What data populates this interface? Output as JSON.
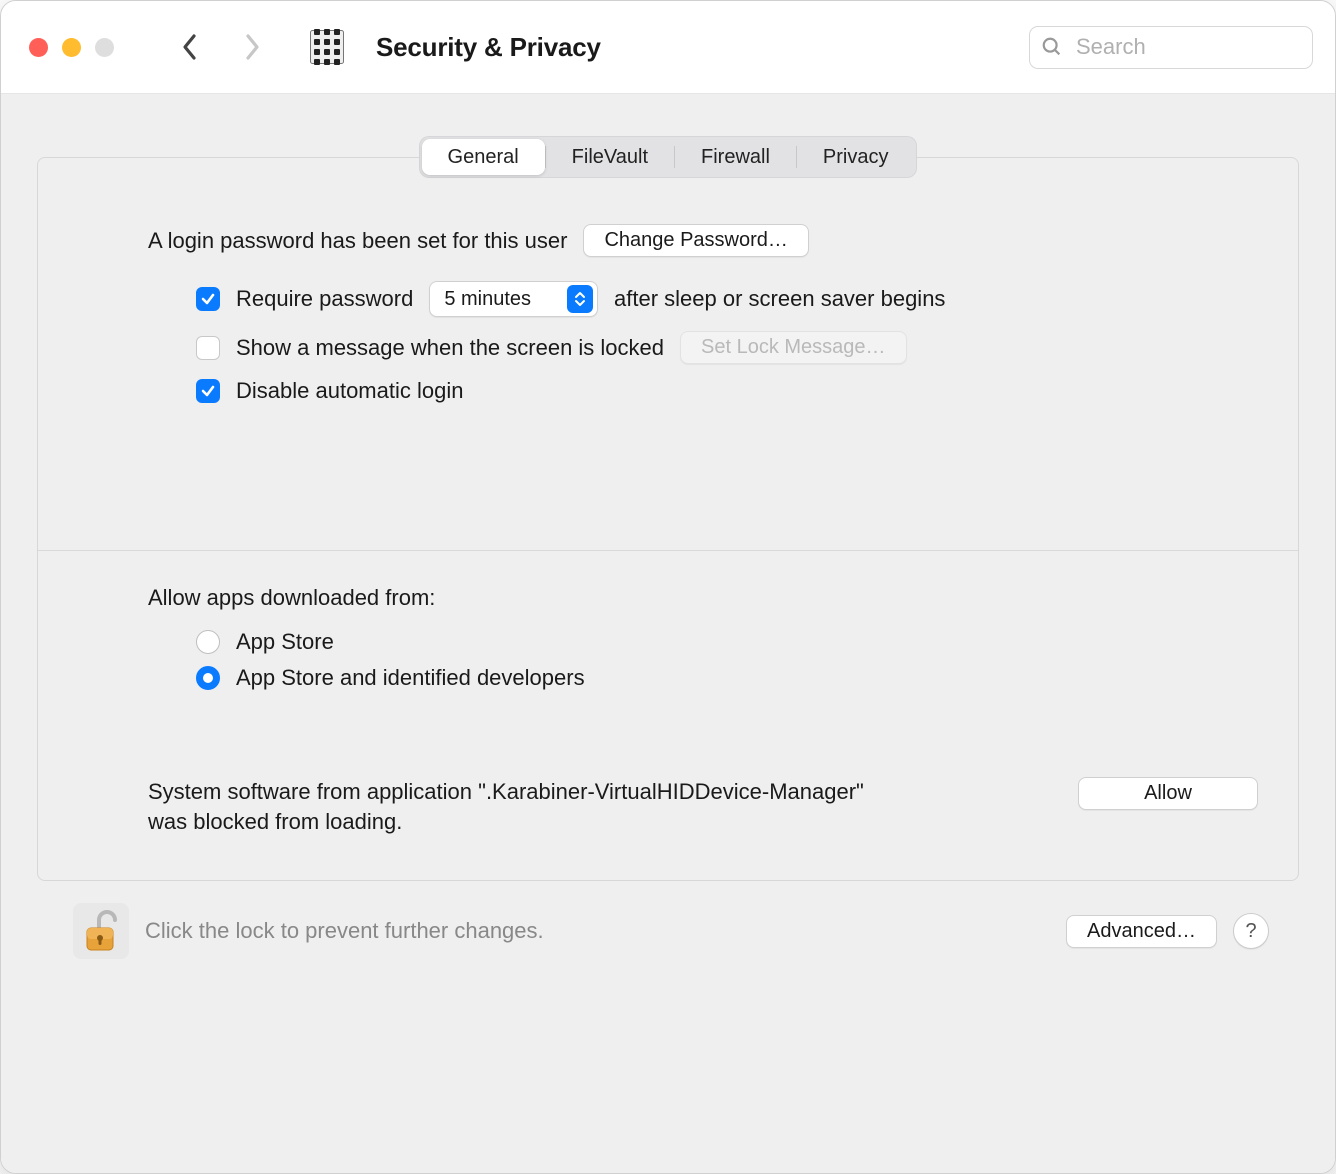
{
  "window": {
    "title": "Security & Privacy"
  },
  "toolbar": {
    "search_placeholder": "Search"
  },
  "tabs": {
    "items": [
      {
        "label": "General",
        "active": true
      },
      {
        "label": "FileVault",
        "active": false
      },
      {
        "label": "Firewall",
        "active": false
      },
      {
        "label": "Privacy",
        "active": false
      }
    ]
  },
  "general": {
    "login_password_text": "A login password has been set for this user",
    "change_password_label": "Change Password…",
    "require_password": {
      "checked": true,
      "prefix": "Require password",
      "delay_value": "5 minutes",
      "suffix": "after sleep or screen saver begins"
    },
    "show_lock_message": {
      "checked": false,
      "label": "Show a message when the screen is locked",
      "button_label": "Set Lock Message…",
      "button_enabled": false
    },
    "disable_auto_login": {
      "checked": true,
      "label": "Disable automatic login"
    },
    "allow_apps": {
      "heading": "Allow apps downloaded from:",
      "options": [
        {
          "label": "App Store",
          "selected": false
        },
        {
          "label": "App Store and identified developers",
          "selected": true
        }
      ]
    },
    "blocked_software": {
      "text": "System software from application \".Karabiner-VirtualHIDDevice-Manager\" was blocked from loading.",
      "allow_label": "Allow"
    }
  },
  "footer": {
    "lock_text": "Click the lock to prevent further changes.",
    "advanced_label": "Advanced…",
    "help_label": "?"
  }
}
